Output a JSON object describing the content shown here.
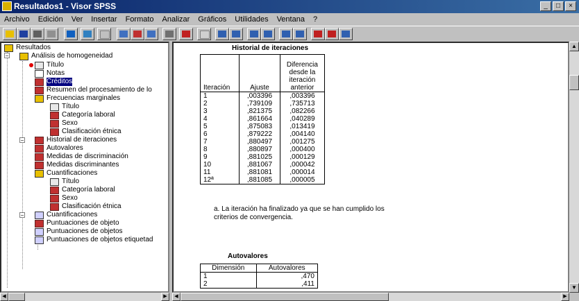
{
  "window": {
    "title": "Resultados1 - Visor SPSS",
    "controls": [
      "_",
      "□",
      "×"
    ]
  },
  "menu": [
    "Archivo",
    "Edición",
    "Ver",
    "Insertar",
    "Formato",
    "Analizar",
    "Gráficos",
    "Utilidades",
    "Ventana",
    "?"
  ],
  "toolbar": {
    "icons": [
      "open-icon",
      "save-icon",
      "print-icon",
      "print-preview-icon",
      "export-icon",
      "dialog-recall-icon",
      "undo-icon",
      "goto-data-icon",
      "goto-case-icon",
      "variables-icon",
      "find-icon",
      "insert-cases-icon",
      "insert-variable-icon",
      "split-file-icon",
      "weight-cases-icon",
      "select-cases-icon",
      "value-labels-icon",
      "use-sets-icon",
      "show-all-icon",
      "hide-icon",
      "promote-icon",
      "demote-icon"
    ]
  },
  "tree": {
    "items": [
      {
        "label": "Resultados",
        "icon": "root"
      },
      {
        "label": "Análisis de homogeneidad",
        "icon": "bookopen"
      },
      {
        "label": "Título",
        "icon": "title"
      },
      {
        "label": "Notas",
        "icon": "notes"
      },
      {
        "label": "Créditos",
        "icon": "table"
      },
      {
        "label": "Resumen del procesamiento de lo",
        "icon": "table"
      },
      {
        "label": "Frecuencias marginales",
        "icon": "bookopen"
      },
      {
        "label": "Título",
        "icon": "title"
      },
      {
        "label": "Categoría laboral",
        "icon": "table"
      },
      {
        "label": "Sexo",
        "icon": "table"
      },
      {
        "label": "Clasificación étnica",
        "icon": "table"
      },
      {
        "label": "Historial de iteraciones",
        "icon": "table"
      },
      {
        "label": "Autovalores",
        "icon": "table"
      },
      {
        "label": "Medidas de discriminación",
        "icon": "table"
      },
      {
        "label": "Medidas discriminantes",
        "icon": "table"
      },
      {
        "label": "Cuantificaciones",
        "icon": "bookopen"
      },
      {
        "label": "Título",
        "icon": "title"
      },
      {
        "label": "Categoría laboral",
        "icon": "table"
      },
      {
        "label": "Sexo",
        "icon": "table"
      },
      {
        "label": "Clasificación étnica",
        "icon": "table"
      },
      {
        "label": "Cuantificaciones",
        "icon": "log"
      },
      {
        "label": "Puntuaciones de objeto",
        "icon": "table"
      },
      {
        "label": "Puntuaciones de objetos",
        "icon": "log"
      },
      {
        "label": "Puntuaciones de objetos etiquetad",
        "icon": "log"
      }
    ]
  },
  "iterations": {
    "title": "Historial de iteraciones",
    "headers": {
      "col1": "Iteración",
      "col2": "Ajuste",
      "col3": "Diferencia desde la iteración anterior"
    },
    "rows": [
      [
        "1",
        ",003396",
        ",003396"
      ],
      [
        "2",
        ",739109",
        ",735713"
      ],
      [
        "3",
        ",821375",
        ",082266"
      ],
      [
        "4",
        ",861664",
        ",040289"
      ],
      [
        "5",
        ",875083",
        ",013419"
      ],
      [
        "6",
        ",879222",
        ",004140"
      ],
      [
        "7",
        ",880497",
        ",001275"
      ],
      [
        "8",
        ",880897",
        ",000400"
      ],
      [
        "9",
        ",881025",
        ",000129"
      ],
      [
        "10",
        ",881067",
        ",000042"
      ],
      [
        "11",
        ",881081",
        ",000014"
      ],
      [
        "12ª",
        ",881085",
        ",000005"
      ]
    ],
    "footnote": "a. La iteración ha finalizado ya que se han cumplido los criterios de convergencia."
  },
  "eigen": {
    "title": "Autovalores",
    "headers": {
      "col1": "Dimensión",
      "col2": "Autovalores"
    },
    "rows": [
      [
        "1",
        ",470"
      ],
      [
        "2",
        ",411"
      ]
    ]
  }
}
